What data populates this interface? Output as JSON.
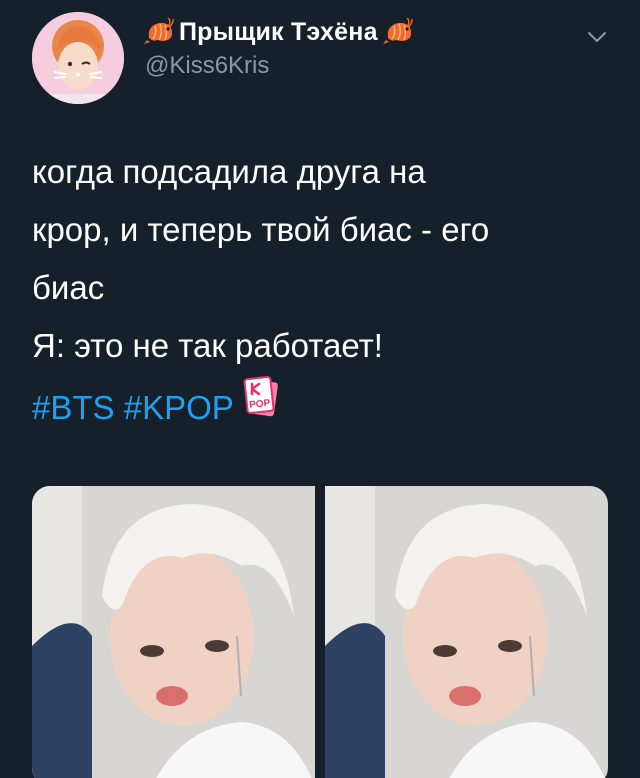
{
  "tweet": {
    "display_name": "Прыщик Тэхёна",
    "handle": "@Kiss6Kris",
    "name_emoji": "shrimp-icon",
    "menu_icon": "chevron-down-icon",
    "text_lines": [
      "когда подсадила друга на",
      "крор, и теперь твой биас - его",
      "биас",
      "Я: это не так работает!"
    ],
    "hashtags": [
      "#BTS",
      "#KPOP"
    ],
    "hashtag_emoji": "kpop-icon",
    "media": [
      {
        "kind": "photo",
        "subject": "person-photo"
      },
      {
        "kind": "photo",
        "subject": "person-photo"
      }
    ]
  },
  "colors": {
    "background": "#15202b",
    "text": "#ffffff",
    "secondary": "#8899a6",
    "link": "#1da1f2"
  }
}
